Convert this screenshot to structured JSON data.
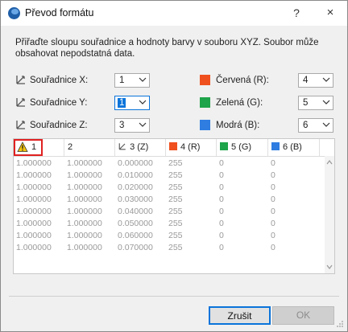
{
  "window": {
    "title": "Převod formátu",
    "help_label": "?",
    "close_label": "×"
  },
  "description": "Přiřaďte sloupu souřadnice a hodnoty barvy v souboru XYZ. Soubor může obsahovat nepodstatná data.",
  "coords": [
    {
      "label": "Souřadnice X:",
      "value": "1",
      "icon": "axis-x-icon"
    },
    {
      "label": "Souřadnice Y:",
      "value": "1",
      "icon": "axis-y-icon"
    },
    {
      "label": "Souřadnice Z:",
      "value": "3",
      "icon": "axis-z-icon"
    }
  ],
  "colors": [
    {
      "label": "Červená (R):",
      "value": "4",
      "color": "#f0501e"
    },
    {
      "label": "Zelená (G):",
      "value": "5",
      "color": "#1ea44a"
    },
    {
      "label": "Modrá (B):",
      "value": "6",
      "color": "#2f7de1"
    }
  ],
  "table": {
    "headers": [
      "1",
      "2",
      "3 (Z)",
      "4 (R)",
      "5 (G)",
      "6 (B)"
    ],
    "header_colors": [
      "",
      "",
      "",
      "#f0501e",
      "#1ea44a",
      "#2f7de1"
    ],
    "rows": [
      [
        "1.000000",
        "1.000000",
        "0.000000",
        "255",
        "0",
        "0"
      ],
      [
        "1.000000",
        "1.000000",
        "0.010000",
        "255",
        "0",
        "0"
      ],
      [
        "1.000000",
        "1.000000",
        "0.020000",
        "255",
        "0",
        "0"
      ],
      [
        "1.000000",
        "1.000000",
        "0.030000",
        "255",
        "0",
        "0"
      ],
      [
        "1.000000",
        "1.000000",
        "0.040000",
        "255",
        "0",
        "0"
      ],
      [
        "1.000000",
        "1.000000",
        "0.050000",
        "255",
        "0",
        "0"
      ],
      [
        "1.000000",
        "1.000000",
        "0.060000",
        "255",
        "0",
        "0"
      ],
      [
        "1.000000",
        "1.000000",
        "0.070000",
        "255",
        "0",
        "0"
      ]
    ]
  },
  "buttons": {
    "cancel": "Zrušit",
    "ok": "OK"
  }
}
